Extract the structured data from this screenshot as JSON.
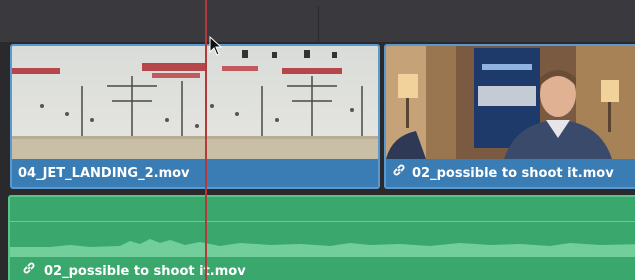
{
  "timeline": {
    "video_clips": [
      {
        "name": "04_JET_LANDING_2.mov",
        "linked": false
      },
      {
        "name": "02_possible to shoot it.mov",
        "linked": true
      }
    ],
    "audio_clip": {
      "name": "02_possible to shoot it.mov",
      "linked": true
    }
  },
  "icons": {
    "link": "link-icon",
    "cursor": "arrow-cursor-icon"
  },
  "colors": {
    "video_clip": "#3d7fb6",
    "audio_clip": "#3aa86d",
    "playhead": "#b23a3a"
  }
}
